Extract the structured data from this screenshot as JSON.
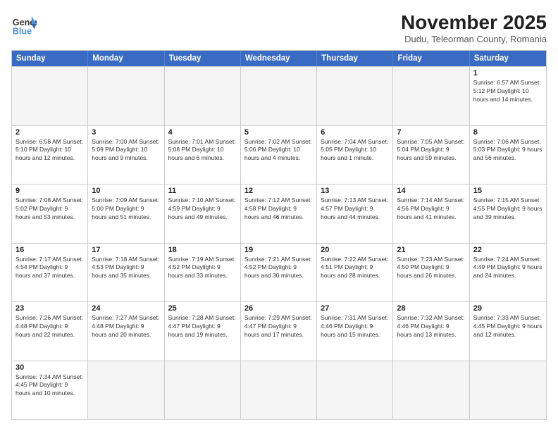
{
  "header": {
    "logo_general": "General",
    "logo_blue": "Blue",
    "month_title": "November 2025",
    "location": "Dudu, Teleorman County, Romania"
  },
  "days_of_week": [
    "Sunday",
    "Monday",
    "Tuesday",
    "Wednesday",
    "Thursday",
    "Friday",
    "Saturday"
  ],
  "weeks": [
    [
      {
        "day": "",
        "info": ""
      },
      {
        "day": "",
        "info": ""
      },
      {
        "day": "",
        "info": ""
      },
      {
        "day": "",
        "info": ""
      },
      {
        "day": "",
        "info": ""
      },
      {
        "day": "",
        "info": ""
      },
      {
        "day": "1",
        "info": "Sunrise: 6:57 AM\nSunset: 5:12 PM\nDaylight: 10 hours and 14 minutes."
      }
    ],
    [
      {
        "day": "2",
        "info": "Sunrise: 6:58 AM\nSunset: 5:10 PM\nDaylight: 10 hours and 12 minutes."
      },
      {
        "day": "3",
        "info": "Sunrise: 7:00 AM\nSunset: 5:09 PM\nDaylight: 10 hours and 9 minutes."
      },
      {
        "day": "4",
        "info": "Sunrise: 7:01 AM\nSunset: 5:08 PM\nDaylight: 10 hours and 6 minutes."
      },
      {
        "day": "5",
        "info": "Sunrise: 7:02 AM\nSunset: 5:06 PM\nDaylight: 10 hours and 4 minutes."
      },
      {
        "day": "6",
        "info": "Sunrise: 7:04 AM\nSunset: 5:05 PM\nDaylight: 10 hours and 1 minute."
      },
      {
        "day": "7",
        "info": "Sunrise: 7:05 AM\nSunset: 5:04 PM\nDaylight: 9 hours and 59 minutes."
      },
      {
        "day": "8",
        "info": "Sunrise: 7:06 AM\nSunset: 5:03 PM\nDaylight: 9 hours and 56 minutes."
      }
    ],
    [
      {
        "day": "9",
        "info": "Sunrise: 7:08 AM\nSunset: 5:02 PM\nDaylight: 9 hours and 53 minutes."
      },
      {
        "day": "10",
        "info": "Sunrise: 7:09 AM\nSunset: 5:00 PM\nDaylight: 9 hours and 51 minutes."
      },
      {
        "day": "11",
        "info": "Sunrise: 7:10 AM\nSunset: 4:59 PM\nDaylight: 9 hours and 49 minutes."
      },
      {
        "day": "12",
        "info": "Sunrise: 7:12 AM\nSunset: 4:58 PM\nDaylight: 9 hours and 46 minutes."
      },
      {
        "day": "13",
        "info": "Sunrise: 7:13 AM\nSunset: 4:57 PM\nDaylight: 9 hours and 44 minutes."
      },
      {
        "day": "14",
        "info": "Sunrise: 7:14 AM\nSunset: 4:56 PM\nDaylight: 9 hours and 41 minutes."
      },
      {
        "day": "15",
        "info": "Sunrise: 7:15 AM\nSunset: 4:55 PM\nDaylight: 9 hours and 39 minutes."
      }
    ],
    [
      {
        "day": "16",
        "info": "Sunrise: 7:17 AM\nSunset: 4:54 PM\nDaylight: 9 hours and 37 minutes."
      },
      {
        "day": "17",
        "info": "Sunrise: 7:18 AM\nSunset: 4:53 PM\nDaylight: 9 hours and 35 minutes."
      },
      {
        "day": "18",
        "info": "Sunrise: 7:19 AM\nSunset: 4:52 PM\nDaylight: 9 hours and 33 minutes."
      },
      {
        "day": "19",
        "info": "Sunrise: 7:21 AM\nSunset: 4:52 PM\nDaylight: 9 hours and 30 minutes."
      },
      {
        "day": "20",
        "info": "Sunrise: 7:22 AM\nSunset: 4:51 PM\nDaylight: 9 hours and 28 minutes."
      },
      {
        "day": "21",
        "info": "Sunrise: 7:23 AM\nSunset: 4:50 PM\nDaylight: 9 hours and 26 minutes."
      },
      {
        "day": "22",
        "info": "Sunrise: 7:24 AM\nSunset: 4:49 PM\nDaylight: 9 hours and 24 minutes."
      }
    ],
    [
      {
        "day": "23",
        "info": "Sunrise: 7:26 AM\nSunset: 4:48 PM\nDaylight: 9 hours and 22 minutes."
      },
      {
        "day": "24",
        "info": "Sunrise: 7:27 AM\nSunset: 4:48 PM\nDaylight: 9 hours and 20 minutes."
      },
      {
        "day": "25",
        "info": "Sunrise: 7:28 AM\nSunset: 4:47 PM\nDaylight: 9 hours and 19 minutes."
      },
      {
        "day": "26",
        "info": "Sunrise: 7:29 AM\nSunset: 4:47 PM\nDaylight: 9 hours and 17 minutes."
      },
      {
        "day": "27",
        "info": "Sunrise: 7:31 AM\nSunset: 4:46 PM\nDaylight: 9 hours and 15 minutes."
      },
      {
        "day": "28",
        "info": "Sunrise: 7:32 AM\nSunset: 4:46 PM\nDaylight: 9 hours and 13 minutes."
      },
      {
        "day": "29",
        "info": "Sunrise: 7:33 AM\nSunset: 4:45 PM\nDaylight: 9 hours and 12 minutes."
      }
    ],
    [
      {
        "day": "30",
        "info": "Sunrise: 7:34 AM\nSunset: 4:45 PM\nDaylight: 9 hours and 10 minutes."
      },
      {
        "day": "",
        "info": ""
      },
      {
        "day": "",
        "info": ""
      },
      {
        "day": "",
        "info": ""
      },
      {
        "day": "",
        "info": ""
      },
      {
        "day": "",
        "info": ""
      },
      {
        "day": "",
        "info": ""
      }
    ]
  ]
}
